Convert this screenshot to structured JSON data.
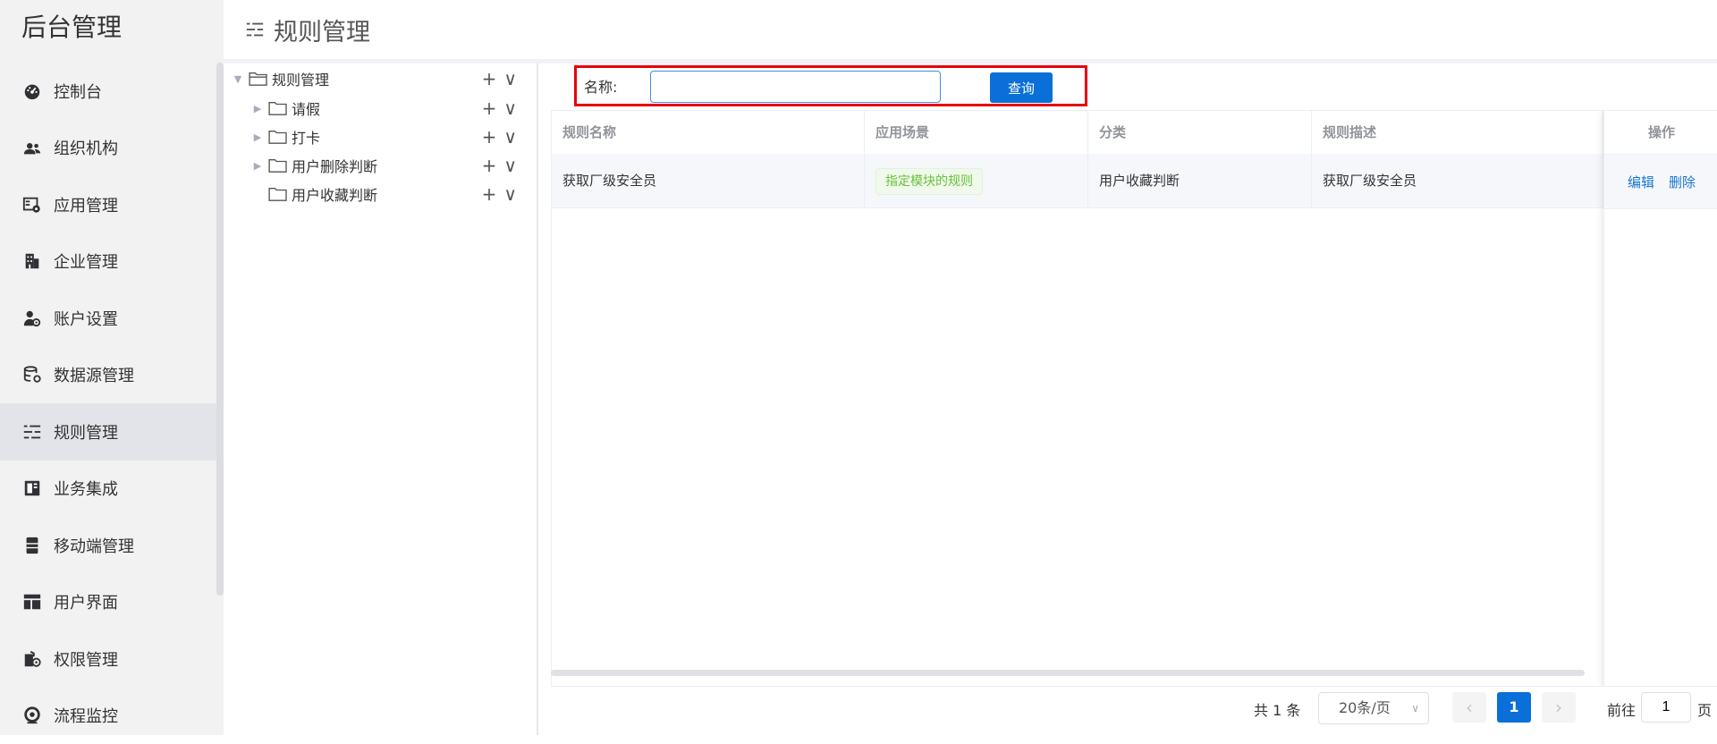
{
  "brand": "后台管理",
  "header": {
    "title": "规则管理",
    "icon": "sliders-icon"
  },
  "sidebar": {
    "items": [
      {
        "label": "控制台",
        "icon": "dashboard-icon",
        "active": false
      },
      {
        "label": "组织机构",
        "icon": "users-icon",
        "active": false
      },
      {
        "label": "应用管理",
        "icon": "app-settings-icon",
        "active": false
      },
      {
        "label": "企业管理",
        "icon": "building-icon",
        "active": false
      },
      {
        "label": "账户设置",
        "icon": "user-gear-icon",
        "active": false
      },
      {
        "label": "数据源管理",
        "icon": "database-icon",
        "active": false
      },
      {
        "label": "规则管理",
        "icon": "sliders-icon",
        "active": true
      },
      {
        "label": "业务集成",
        "icon": "integration-icon",
        "active": false
      },
      {
        "label": "移动端管理",
        "icon": "mobile-icon",
        "active": false
      },
      {
        "label": "用户界面",
        "icon": "layout-icon",
        "active": false
      },
      {
        "label": "权限管理",
        "icon": "permission-icon",
        "active": false
      },
      {
        "label": "流程监控",
        "icon": "monitor-icon",
        "active": false
      }
    ]
  },
  "tree": {
    "root": {
      "label": "规则管理",
      "expanded": true
    },
    "children": [
      {
        "label": "请假",
        "has_children": true
      },
      {
        "label": "打卡",
        "has_children": true
      },
      {
        "label": "用户删除判断",
        "has_children": true
      },
      {
        "label": "用户收藏判断",
        "has_children": false
      }
    ],
    "add_symbol": "+",
    "more_symbol": "∨"
  },
  "search": {
    "label": "名称:",
    "value": "",
    "placeholder": "",
    "button": "查询"
  },
  "table": {
    "columns": [
      "规则名称",
      "应用场景",
      "分类",
      "规则描述"
    ],
    "action_header": "操作",
    "rows": [
      {
        "name": "获取厂级安全员",
        "scene": "指定模块的规则",
        "category": "用户收藏判断",
        "description": "获取厂级安全员",
        "edit": "编辑",
        "delete": "删除"
      }
    ]
  },
  "pagination": {
    "total_text": "共 1 条",
    "page_size": "20条/页",
    "prev": "‹",
    "next": "›",
    "current_page": "1",
    "goto_label": "前往",
    "goto_value": "1",
    "page_suffix": "页"
  },
  "colors": {
    "primary": "#0a6fd8",
    "highlight_border": "#e8000b",
    "tag_green": "#67c23a"
  }
}
